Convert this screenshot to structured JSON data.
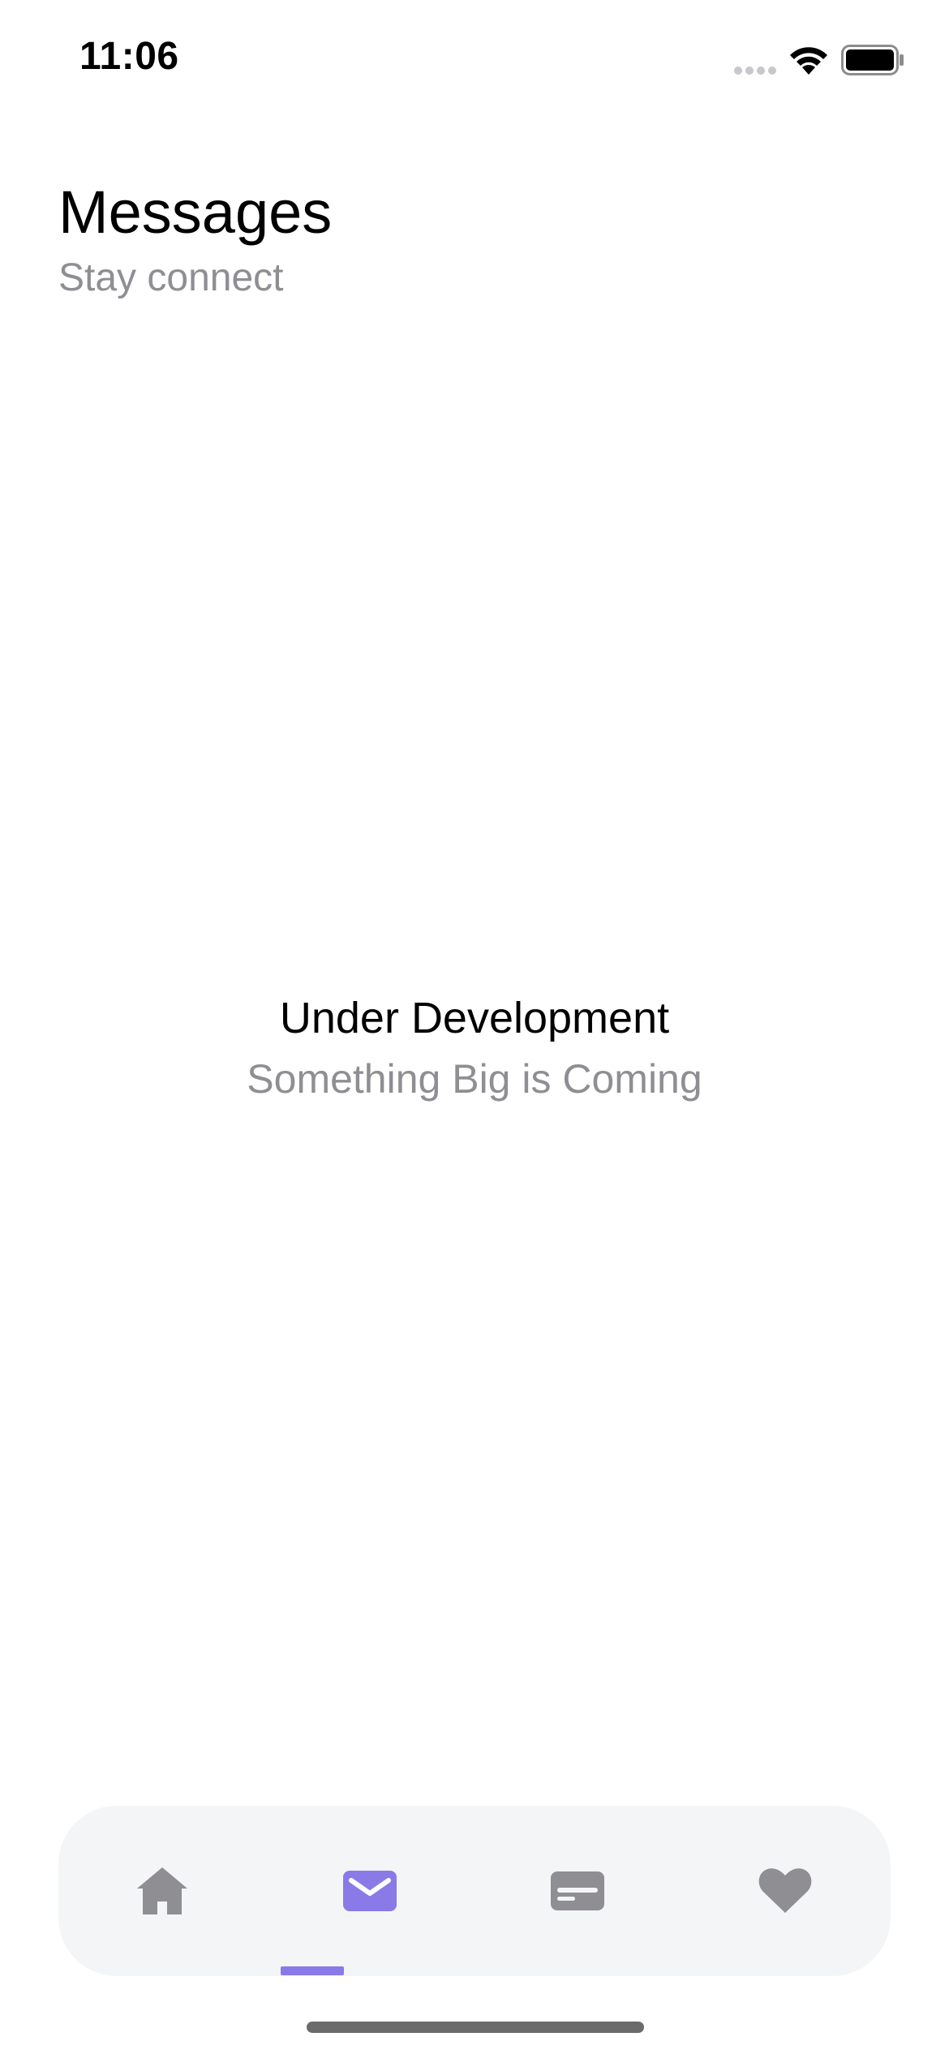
{
  "status_bar": {
    "time": "11:06",
    "signal_icon": "cellular-signal-icon",
    "wifi_icon": "wifi-icon",
    "battery_icon": "battery-icon"
  },
  "header": {
    "title": "Messages",
    "subtitle": "Stay connect"
  },
  "empty_state": {
    "title": "Under Development",
    "subtitle": "Something Big is Coming"
  },
  "tab_bar": {
    "active_tab": "messages",
    "tabs": [
      {
        "id": "home",
        "icon": "home-icon"
      },
      {
        "id": "messages",
        "icon": "mail-icon"
      },
      {
        "id": "cards",
        "icon": "credit-card-icon"
      },
      {
        "id": "favorites",
        "icon": "heart-icon"
      }
    ]
  },
  "colors": {
    "accent": "#8a7ae8",
    "inactive_icon": "#8e8e93",
    "tab_bar_background": "#f4f5f7",
    "secondary_text": "#8e8e93"
  }
}
